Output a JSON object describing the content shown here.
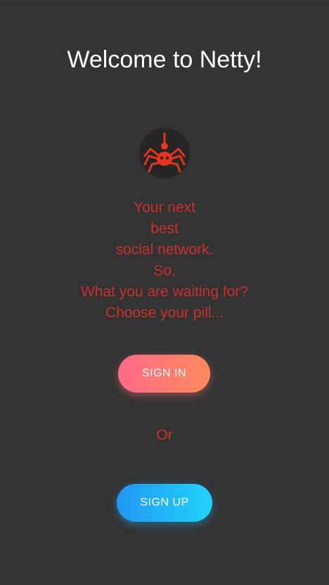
{
  "header": {
    "title": "Welcome to Netty!"
  },
  "logo": {
    "icon": "spider-icon",
    "color": "#e8341f"
  },
  "tagline": {
    "lines": [
      "Your next",
      "best",
      "social network.",
      "So,",
      "What you are waiting for?",
      "Choose your pill..."
    ],
    "color": "#c9302c"
  },
  "actions": {
    "signin_label": "SIGN IN",
    "or_label": "Or",
    "signup_label": "SIGN UP"
  },
  "colors": {
    "background": "#333333",
    "signin_gradient": [
      "#ff6a88",
      "#ff8a5c"
    ],
    "signup_gradient": [
      "#2196f3",
      "#21d4fd"
    ]
  }
}
